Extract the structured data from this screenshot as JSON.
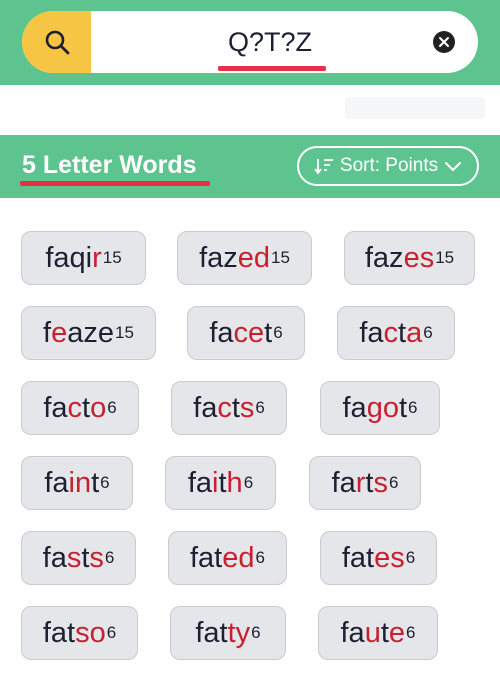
{
  "search": {
    "query": "Q?T?Z"
  },
  "section": {
    "title": "5 Letter Words",
    "sort_label": "Sort: Points"
  },
  "colors": {
    "accent_green": "#5ec48f",
    "search_yellow": "#f6c544",
    "highlight_red": "#c8202f",
    "tile_gray": "#e5e6ea"
  },
  "icons": {
    "search": "magnifier-icon",
    "clear": "close-circle-icon",
    "sort": "sort-descending-icon",
    "dropdown": "chevron-down-icon"
  },
  "words": [
    {
      "parts": [
        [
          "fa",
          false
        ],
        [
          "qi",
          false
        ],
        [
          "r",
          true
        ]
      ],
      "word": "faqir",
      "points": "15"
    },
    {
      "parts": [
        [
          "faz",
          false
        ],
        [
          "ed",
          true
        ]
      ],
      "word": "fazed",
      "points": "15"
    },
    {
      "parts": [
        [
          "faz",
          false
        ],
        [
          "es",
          true
        ]
      ],
      "word": "fazes",
      "points": "15"
    },
    {
      "parts": [
        [
          "f",
          false
        ],
        [
          "e",
          true
        ],
        [
          "aze",
          false
        ]
      ],
      "word": "feaze",
      "points": "15"
    },
    {
      "parts": [
        [
          "fa",
          false
        ],
        [
          "ce",
          true
        ],
        [
          "t",
          false
        ]
      ],
      "word": "facet",
      "points": "6"
    },
    {
      "parts": [
        [
          "fa",
          false
        ],
        [
          "c",
          true
        ],
        [
          "t",
          false
        ],
        [
          "a",
          true
        ]
      ],
      "word": "facta",
      "points": "6"
    },
    {
      "parts": [
        [
          "fa",
          false
        ],
        [
          "c",
          true
        ],
        [
          "t",
          false
        ],
        [
          "o",
          true
        ]
      ],
      "word": "facto",
      "points": "6"
    },
    {
      "parts": [
        [
          "fa",
          false
        ],
        [
          "c",
          true
        ],
        [
          "t",
          false
        ],
        [
          "s",
          true
        ]
      ],
      "word": "facts",
      "points": "6"
    },
    {
      "parts": [
        [
          "fa",
          false
        ],
        [
          "go",
          true
        ],
        [
          "t",
          false
        ]
      ],
      "word": "fagot",
      "points": "6"
    },
    {
      "parts": [
        [
          "fa",
          false
        ],
        [
          "in",
          true
        ],
        [
          "t",
          false
        ]
      ],
      "word": "faint",
      "points": "6"
    },
    {
      "parts": [
        [
          "fa",
          false
        ],
        [
          "i",
          true
        ],
        [
          "t",
          false
        ],
        [
          "h",
          true
        ]
      ],
      "word": "faith",
      "points": "6"
    },
    {
      "parts": [
        [
          "fa",
          false
        ],
        [
          "r",
          true
        ],
        [
          "t",
          false
        ],
        [
          "s",
          true
        ]
      ],
      "word": "farts",
      "points": "6"
    },
    {
      "parts": [
        [
          "fa",
          false
        ],
        [
          "s",
          true
        ],
        [
          "t",
          false
        ],
        [
          "s",
          true
        ]
      ],
      "word": "fasts",
      "points": "6"
    },
    {
      "parts": [
        [
          "fat",
          false
        ],
        [
          "ed",
          true
        ]
      ],
      "word": "fated",
      "points": "6"
    },
    {
      "parts": [
        [
          "fat",
          false
        ],
        [
          "es",
          true
        ]
      ],
      "word": "fates",
      "points": "6"
    },
    {
      "parts": [
        [
          "fat",
          false
        ],
        [
          "so",
          true
        ]
      ],
      "word": "fatso",
      "points": "6"
    },
    {
      "parts": [
        [
          "fat",
          false
        ],
        [
          "ty",
          true
        ]
      ],
      "word": "fatty",
      "points": "6"
    },
    {
      "parts": [
        [
          "fa",
          false
        ],
        [
          "u",
          true
        ],
        [
          "t",
          false
        ],
        [
          "e",
          true
        ]
      ],
      "word": "faute",
      "points": "6"
    }
  ]
}
